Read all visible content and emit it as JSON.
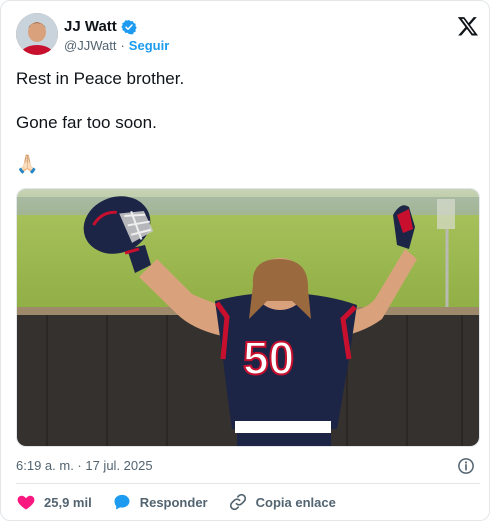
{
  "author": {
    "name": "JJ Watt",
    "handle": "@JJWatt",
    "separator": "·",
    "follow_label": "Seguir",
    "verified_color": "#1d9bf0"
  },
  "post": {
    "line1": "Rest in Peace brother.",
    "line2": "Gone far too soon.",
    "emoji": "🙏🏻"
  },
  "media": {
    "jersey_number": "50",
    "alt": "Player in navy jersey raising helmet"
  },
  "meta": {
    "timestamp": "6:19 a. m. · 17 jul. 2025"
  },
  "actions": {
    "likes": "25,9 mil",
    "reply_label": "Responder",
    "copy_label": "Copia enlace"
  },
  "colors": {
    "like": "#f91880",
    "reply": "#1d9bf0",
    "text_secondary": "#536471"
  }
}
